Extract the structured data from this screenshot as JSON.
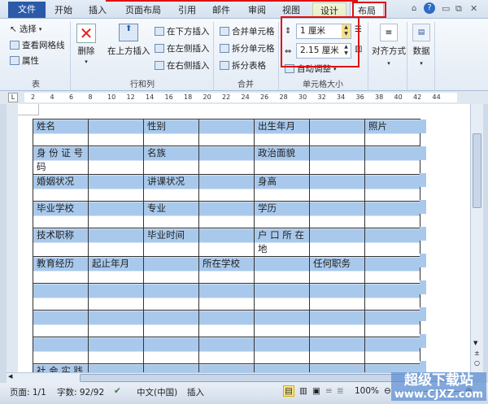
{
  "tabs": [
    "文件",
    "开始",
    "插入",
    "页面布局",
    "引用",
    "邮件",
    "审阅",
    "视图",
    "设计",
    "布局"
  ],
  "ribbon": {
    "table": {
      "select": "选择",
      "gridlines": "查看网格线",
      "properties": "属性",
      "label": "表"
    },
    "rows_cols": {
      "delete": "删除",
      "insert_above": "在上方插入",
      "insert_below": "在下方插入",
      "insert_left": "在左侧插入",
      "insert_right": "在右侧插入",
      "label": "行和列"
    },
    "merge": {
      "merge_cells": "合并单元格",
      "split_cells": "拆分单元格",
      "split_table": "拆分表格",
      "label": "合并"
    },
    "cell_size": {
      "height": "1 厘米",
      "width": "2.15 厘米",
      "autofit": "自动调整",
      "label": "单元格大小"
    },
    "alignment": "对齐方式",
    "data": "数据"
  },
  "ruler": [
    "2",
    "4",
    "6",
    "8",
    "10",
    "12",
    "14",
    "16",
    "18",
    "20",
    "22",
    "24",
    "26",
    "28",
    "30",
    "32",
    "34",
    "36",
    "38",
    "40",
    "42",
    "44"
  ],
  "table_rows": [
    [
      "姓名",
      "",
      "性别",
      "",
      "出生年月",
      "",
      "照片"
    ],
    [
      "身 份 证 号 码",
      "",
      "名族",
      "",
      "政治面貌",
      "",
      ""
    ],
    [
      "婚姻状况",
      "",
      "讲课状况",
      "",
      "身高",
      "",
      ""
    ],
    [
      "毕业学校",
      "",
      "专业",
      "",
      "学历",
      "",
      ""
    ],
    [
      "技术职称",
      "",
      "毕业时间",
      "",
      "户 口 所 在 地",
      "",
      ""
    ],
    [
      "教育经历",
      "起止年月",
      "",
      "所在学校",
      "",
      "任何职务",
      ""
    ],
    [
      "",
      "",
      "",
      "",
      "",
      "",
      ""
    ],
    [
      "",
      "",
      "",
      "",
      "",
      "",
      ""
    ],
    [
      "",
      "",
      "",
      "",
      "",
      "",
      ""
    ],
    [
      "社 会 实 践",
      "",
      "",
      "",
      "",
      "",
      ""
    ]
  ],
  "status": {
    "page": "页面: 1/1",
    "words": "字数: 92/92",
    "lang": "中文(中国)",
    "mode": "插入",
    "zoom": "100%"
  },
  "watermark": {
    "title": "超级下载站",
    "url": "www.CJXZ.com"
  }
}
